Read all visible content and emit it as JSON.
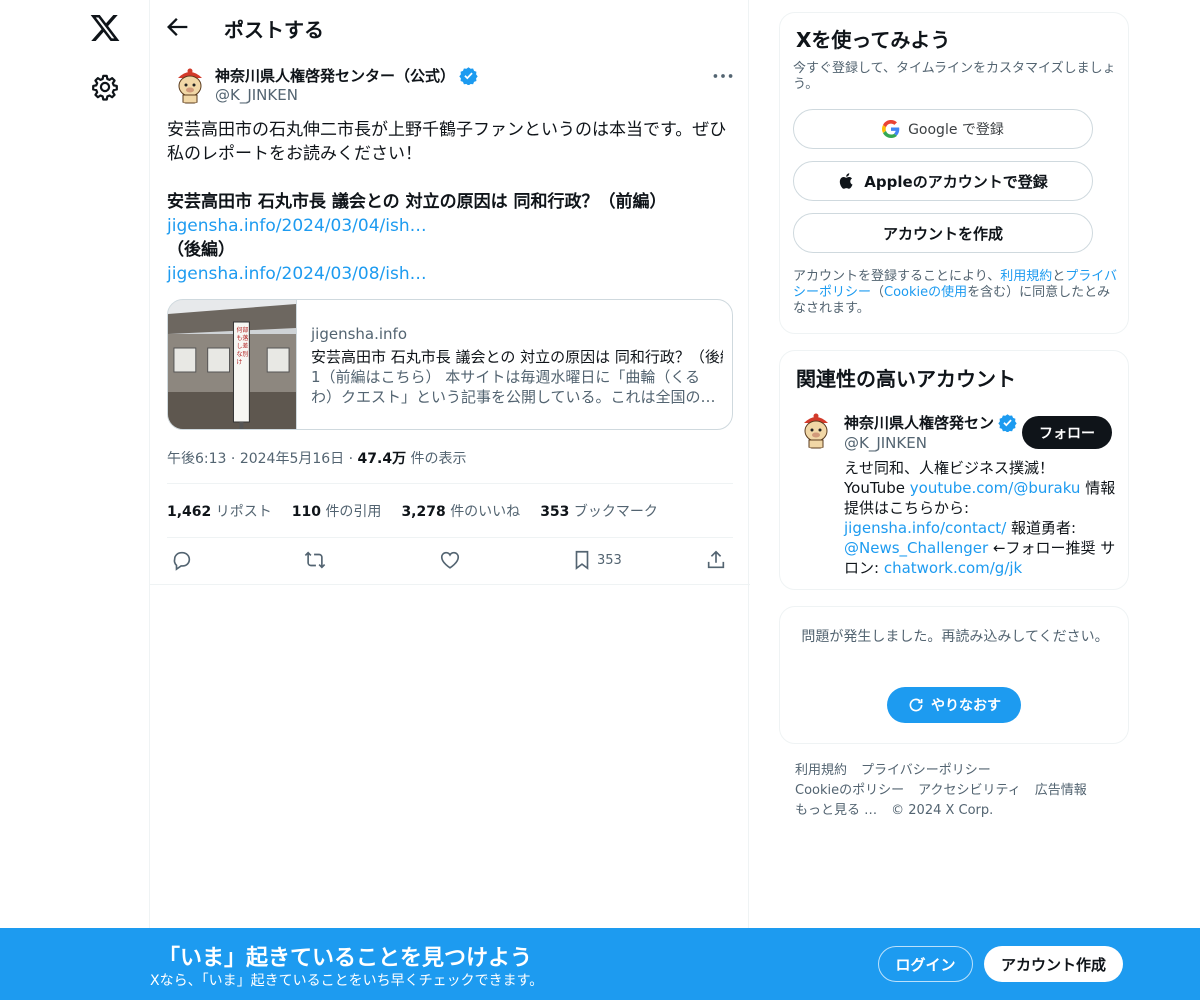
{
  "header": {
    "title": "ポストする"
  },
  "post": {
    "author_name": "神奈川県人権啓発センター（公式）",
    "author_handle": "@K_JINKEN",
    "text_line1": "安芸高田市の石丸伸二市長が上野千鶴子ファンというのは本当です。ぜひ",
    "text_line2": "私のレポートをお読みください！",
    "headline1": "安芸高田市 石丸市長 議会との 対立の原因は 同和行政？（前編）",
    "link1": "jigensha.info/2024/03/04/ish…",
    "headline2": "（後編）",
    "link2": "jigensha.info/2024/03/08/ish…",
    "card": {
      "domain": "jigensha.info",
      "title": "安芸高田市 石丸市長 議会との 対立の原因は 同和行政？（後編）",
      "description": "1（前編はこちら） 本サイトは毎週水曜日に「曲輪（くるわ）クエスト」という記事を公開している。これは全国の…",
      "sign_text": "何もしなければ差別はなくならない 部落差別をなくそう"
    },
    "time": "午後6:13",
    "date": "2024年5月16日",
    "views_count": "47.4万",
    "views_label": "件の表示",
    "stats": {
      "reposts_count": "1,462",
      "reposts_label": "リポスト",
      "quotes_count": "110",
      "quotes_label": "件の引用",
      "likes_count": "3,278",
      "likes_label": "件のいいね",
      "bookmarks_count": "353",
      "bookmarks_label": "ブックマーク"
    },
    "bookmark_action_count": "353"
  },
  "signup_panel": {
    "title": "Xを使ってみよう",
    "subtitle": "今すぐ登録して、タイムラインをカスタマイズしましょう。",
    "google_label": "Google で登録",
    "apple_label": "Appleのアカウントで登録",
    "create_label": "アカウントを作成",
    "legal_prefix": "アカウントを登録することにより、",
    "legal_terms": "利用規約",
    "legal_and": "と",
    "legal_privacy": "プライバシーポリシー",
    "legal_open": "（",
    "legal_cookie": "Cookieの使用",
    "legal_suffix": "を含む）に同意したとみなされます。"
  },
  "related_panel": {
    "title": "関連性の高いアカウント",
    "name": "神奈川県人権啓発セン",
    "handle": "@K_JINKEN",
    "follow_label": "フォロー",
    "bio_1": "えせ同和、人権ビジネス撲滅！",
    "bio_2": "YouTube ",
    "bio_link1": "youtube.com/@buraku",
    "bio_3": " 情報提供はこちらから: ",
    "bio_link2": "jigensha.info/contact/",
    "bio_4": " 報道勇者: ",
    "bio_link3": "@News_Challenger",
    "bio_5": " ←フォロー推奨 サロン: ",
    "bio_link4": "chatwork.com/g/jk"
  },
  "error_panel": {
    "message": "問題が発生しました。再読み込みしてください。",
    "retry_label": "やりなおす"
  },
  "footer": {
    "terms": "利用規約",
    "privacy": "プライバシーポリシー",
    "cookie": "Cookieのポリシー",
    "accessibility": "アクセシビリティ",
    "ads": "広告情報",
    "more": "もっと見る …",
    "copyright": "© 2024 X Corp."
  },
  "bottom_bar": {
    "title": "「いま」起きていることを見つけよう",
    "subtitle": "Xなら、「いま」起きていることをいち早くチェックできます。",
    "login_label": "ログイン",
    "signup_label": "アカウント作成"
  },
  "colors": {
    "accent": "#1d9bf0",
    "text": "#0f1419",
    "muted": "#536471",
    "border": "#eff3f4"
  }
}
